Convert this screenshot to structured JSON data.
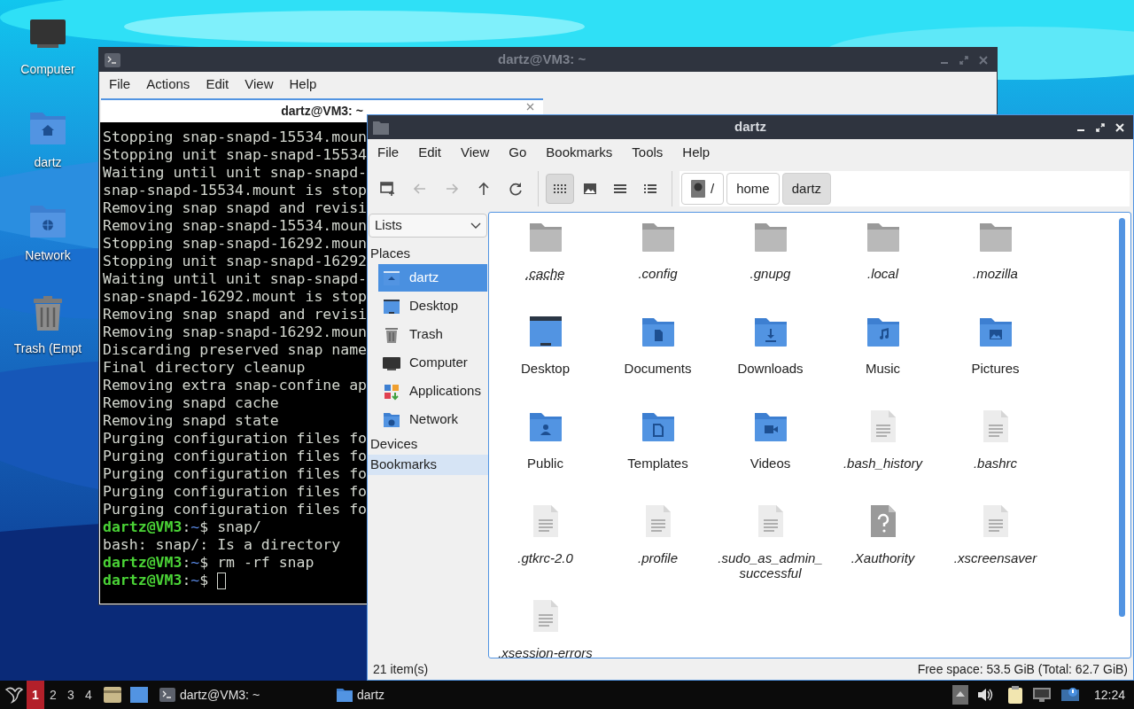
{
  "desktop": {
    "icons": [
      {
        "kind": "computer",
        "label": "Computer"
      },
      {
        "kind": "home-folder",
        "label": "dartz"
      },
      {
        "kind": "network-folder",
        "label": "Network"
      },
      {
        "kind": "trash",
        "label": "Trash (Empt"
      }
    ]
  },
  "terminal_window": {
    "title": "dartz@VM3: ~",
    "active": false,
    "menu": [
      "File",
      "Actions",
      "Edit",
      "View",
      "Help"
    ],
    "tabs": [
      {
        "label": "dartz@VM3: ~",
        "selected": true
      }
    ],
    "lines": [
      {
        "kind": "output",
        "text": "Stopping snap-snapd-15534.moun"
      },
      {
        "kind": "output",
        "text": "Stopping unit snap-snapd-15534"
      },
      {
        "kind": "output",
        "text": "Waiting until unit snap-snapd-"
      },
      {
        "kind": "output",
        "text": "snap-snapd-15534.mount is stop"
      },
      {
        "kind": "output",
        "text": "Removing snap snapd and revisi"
      },
      {
        "kind": "output",
        "text": "Removing snap-snapd-15534.moun"
      },
      {
        "kind": "output",
        "text": "Stopping snap-snapd-16292.moun"
      },
      {
        "kind": "output",
        "text": "Stopping unit snap-snapd-16292"
      },
      {
        "kind": "output",
        "text": "Waiting until unit snap-snapd-"
      },
      {
        "kind": "output",
        "text": "snap-snapd-16292.mount is stop"
      },
      {
        "kind": "output",
        "text": "Removing snap snapd and revisi"
      },
      {
        "kind": "output",
        "text": "Removing snap-snapd-16292.moun"
      },
      {
        "kind": "output",
        "text": "Discarding preserved snap name"
      },
      {
        "kind": "output",
        "text": "Final directory cleanup"
      },
      {
        "kind": "output",
        "text": "Removing extra snap-confine ap"
      },
      {
        "kind": "output",
        "text": "Removing snapd cache"
      },
      {
        "kind": "output",
        "text": "Removing snapd state"
      },
      {
        "kind": "output",
        "text": "Purging configuration files fo"
      },
      {
        "kind": "output",
        "text": "Purging configuration files fo"
      },
      {
        "kind": "output",
        "text": "Purging configuration files fo"
      },
      {
        "kind": "output",
        "text": "Purging configuration files fo"
      },
      {
        "kind": "output",
        "text": "Purging configuration files fo"
      },
      {
        "kind": "prompt",
        "user": "dartz@VM3",
        "separator": ":",
        "path": "~",
        "symbol": "$",
        "command": "snap/",
        "cursor": false
      },
      {
        "kind": "output",
        "text": "bash: snap/: Is a directory"
      },
      {
        "kind": "prompt",
        "user": "dartz@VM3",
        "separator": ":",
        "path": "~",
        "symbol": "$",
        "command": "rm -rf snap",
        "cursor": false
      },
      {
        "kind": "prompt",
        "user": "dartz@VM3",
        "separator": ":",
        "path": "~",
        "symbol": "$",
        "cursor": true
      }
    ]
  },
  "file_manager": {
    "title": "dartz",
    "active": true,
    "menu": [
      "File",
      "Edit",
      "View",
      "Go",
      "Bookmarks",
      "Tools",
      "Help"
    ],
    "toolbar": {
      "nav": [
        {
          "kind": "new-window",
          "disabled": false
        },
        {
          "kind": "back",
          "disabled": true
        },
        {
          "kind": "forward",
          "disabled": true
        },
        {
          "kind": "up",
          "disabled": false
        },
        {
          "kind": "reload",
          "disabled": false
        }
      ],
      "views": [
        {
          "kind": "icons",
          "selected": true
        },
        {
          "kind": "thumbnails",
          "selected": false
        },
        {
          "kind": "compact",
          "selected": false
        },
        {
          "kind": "details",
          "selected": false
        }
      ]
    },
    "path": [
      {
        "kind": "root",
        "label": "/",
        "selected": false
      },
      {
        "kind": "dir",
        "label": "home",
        "selected": false
      },
      {
        "kind": "dir",
        "label": "dartz",
        "selected": true
      }
    ],
    "side_pane": {
      "mode": "Lists",
      "sections": [
        {
          "label": "Places",
          "highlighted": false,
          "items": [
            {
              "kind": "home",
              "label": "dartz",
              "selected": true
            },
            {
              "kind": "desktop",
              "label": "Desktop",
              "selected": false
            },
            {
              "kind": "trash",
              "label": "Trash",
              "selected": false
            },
            {
              "kind": "computer",
              "label": "Computer",
              "selected": false
            },
            {
              "kind": "applications",
              "label": "Applications",
              "selected": false
            },
            {
              "kind": "network",
              "label": "Network",
              "selected": false
            }
          ]
        },
        {
          "label": "Devices",
          "highlighted": false
        },
        {
          "label": "Bookmarks",
          "highlighted": true
        }
      ]
    },
    "items": [
      {
        "kind": "hidden-folder",
        "name": ".cache",
        "hidden": true,
        "focused": true
      },
      {
        "kind": "hidden-folder",
        "name": ".config",
        "hidden": true,
        "focused": false
      },
      {
        "kind": "hidden-folder",
        "name": ".gnupg",
        "hidden": true,
        "focused": false
      },
      {
        "kind": "hidden-folder",
        "name": ".local",
        "hidden": true,
        "focused": false
      },
      {
        "kind": "hidden-folder",
        "name": ".mozilla",
        "hidden": true,
        "focused": false
      },
      {
        "kind": "desktop",
        "name": "Desktop",
        "hidden": false,
        "focused": false
      },
      {
        "kind": "documents",
        "name": "Documents",
        "hidden": false,
        "focused": false
      },
      {
        "kind": "downloads",
        "name": "Downloads",
        "hidden": false,
        "focused": false
      },
      {
        "kind": "music",
        "name": "Music",
        "hidden": false,
        "focused": false
      },
      {
        "kind": "pictures",
        "name": "Pictures",
        "hidden": false,
        "focused": false
      },
      {
        "kind": "public",
        "name": "Public",
        "hidden": false,
        "focused": false
      },
      {
        "kind": "templates",
        "name": "Templates",
        "hidden": false,
        "focused": false
      },
      {
        "kind": "videos",
        "name": "Videos",
        "hidden": false,
        "focused": false
      },
      {
        "kind": "text-file",
        "name": ".bash_history",
        "hidden": true,
        "focused": false
      },
      {
        "kind": "text-file",
        "name": ".bashrc",
        "hidden": true,
        "focused": false
      },
      {
        "kind": "text-file",
        "name": ".gtkrc-2.0",
        "hidden": true,
        "focused": false
      },
      {
        "kind": "text-file",
        "name": ".profile",
        "hidden": true,
        "focused": false
      },
      {
        "kind": "text-file",
        "name": ".sudo_as_admin_successful",
        "hidden": true,
        "focused": false
      },
      {
        "kind": "unknown-file",
        "name": ".Xauthority",
        "hidden": true,
        "focused": false
      },
      {
        "kind": "text-file",
        "name": ".xscreensaver",
        "hidden": true,
        "focused": false
      },
      {
        "kind": "text-file",
        "name": ".xsession-errors",
        "hidden": true,
        "focused": false
      }
    ],
    "status_left": "21 item(s)",
    "status_right": "Free space: 53.5 GiB (Total: 62.7 GiB)"
  },
  "taskbar": {
    "workspaces": [
      {
        "label": "1",
        "selected": true
      },
      {
        "label": "2",
        "selected": false
      },
      {
        "label": "3",
        "selected": false
      },
      {
        "label": "4",
        "selected": false
      }
    ],
    "tasks": [
      {
        "kind": "terminal",
        "label": "dartz@VM3: ~"
      },
      {
        "kind": "folder",
        "label": "dartz"
      }
    ],
    "clock": "12:24"
  }
}
